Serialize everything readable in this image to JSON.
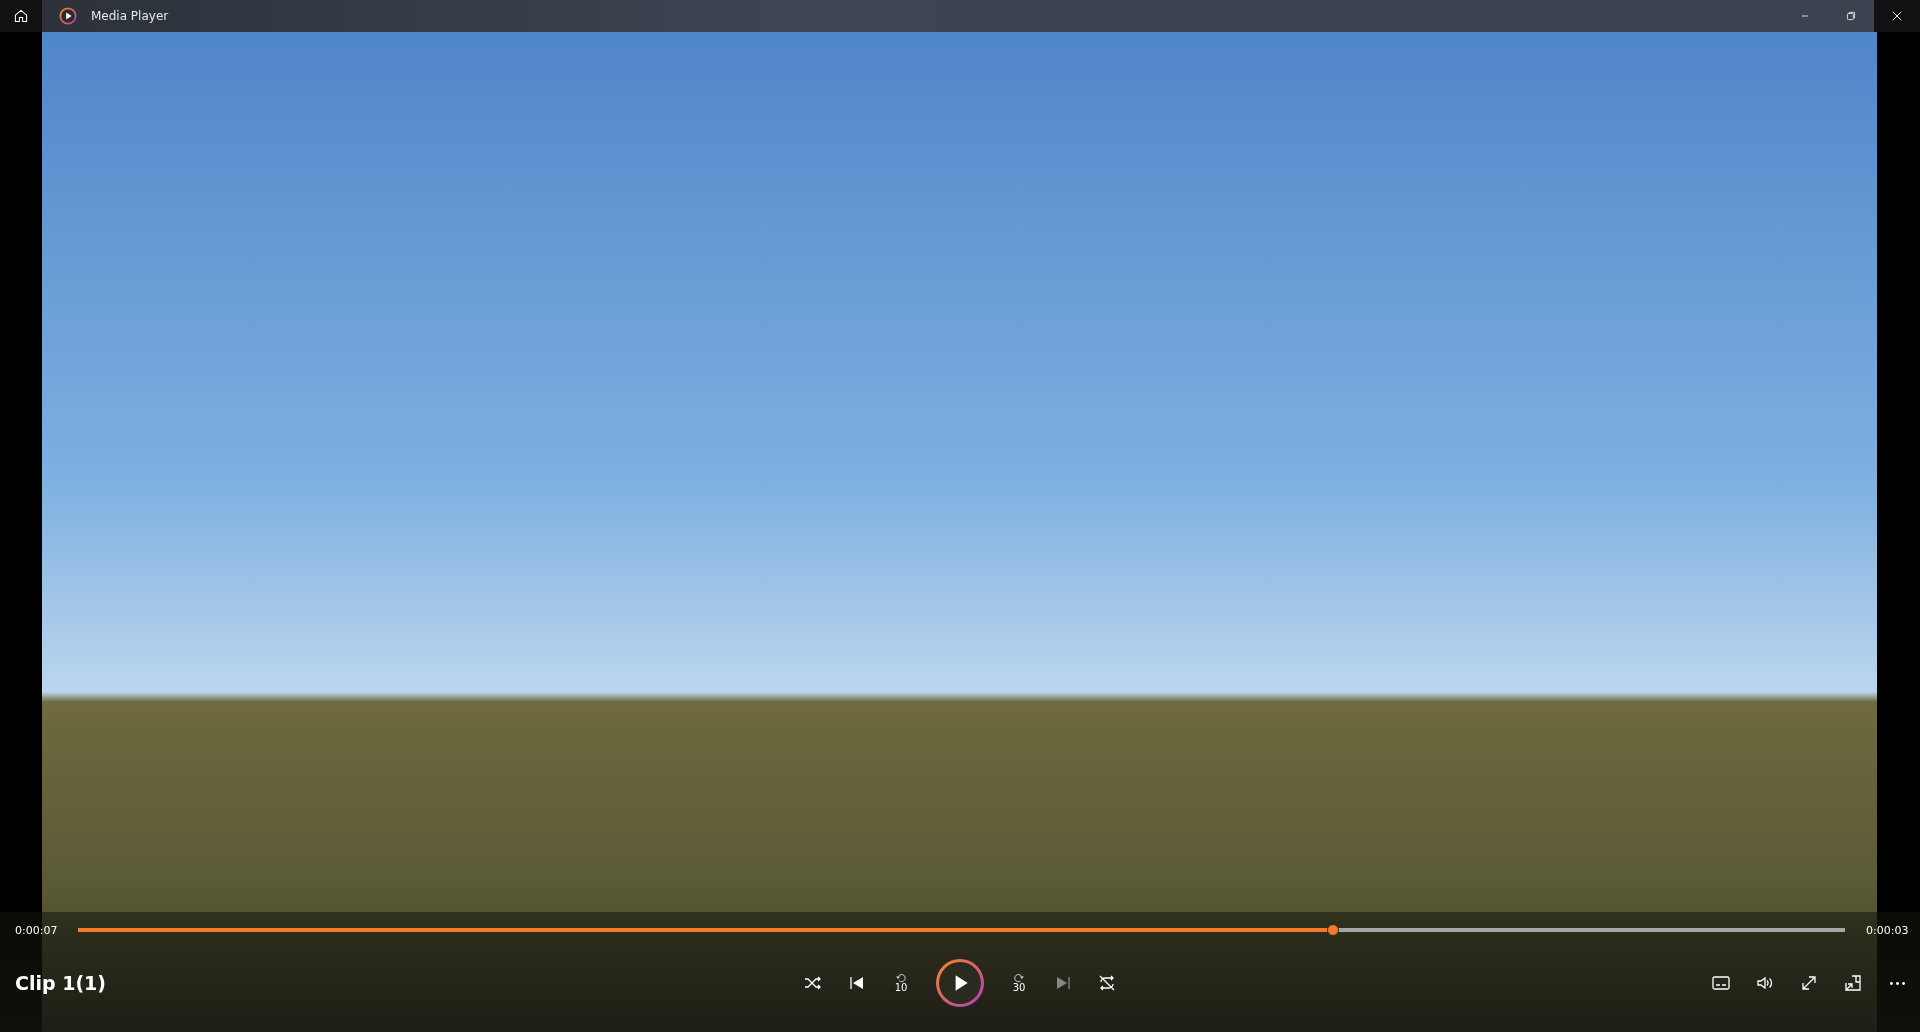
{
  "window": {
    "title": "Media Player"
  },
  "playback": {
    "elapsed": "0:00:07",
    "remaining": "0:00:03",
    "level": 0.71
  },
  "clip": {
    "title": "Clip 1(1)"
  },
  "controls": [
    {
      "kind": "shuffle",
      "disabled": false
    },
    {
      "kind": "previous",
      "disabled": false
    },
    {
      "kind": "skip-back",
      "label": "10",
      "disabled": false
    },
    {
      "kind": "play",
      "disabled": false
    },
    {
      "kind": "skip-forward",
      "label": "30",
      "disabled": false
    },
    {
      "kind": "next",
      "disabled": true
    },
    {
      "kind": "repeat",
      "disabled": false
    }
  ],
  "tools": [
    {
      "kind": "subtitles"
    },
    {
      "kind": "volume"
    },
    {
      "kind": "fullscreen"
    },
    {
      "kind": "mini-player"
    },
    {
      "kind": "more"
    }
  ]
}
